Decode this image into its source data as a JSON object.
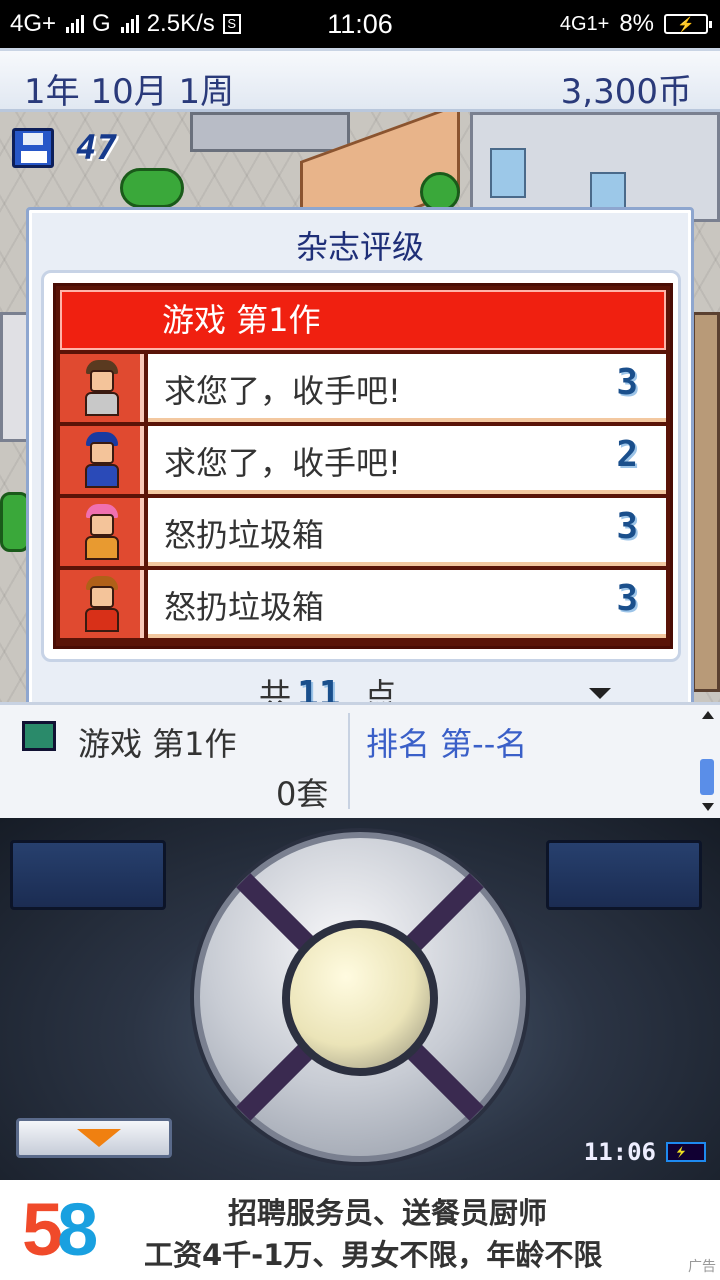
{
  "status_bar": {
    "network_left": "4G+",
    "network_mid": "G",
    "speed": "2.5K/s",
    "app_icon": "S",
    "time": "11:06",
    "network_right": "4G1+",
    "battery_pct": "8%"
  },
  "header": {
    "date": "1年 10月 1周",
    "money": "3,300币"
  },
  "hud": {
    "save_count": "47"
  },
  "dialog": {
    "title": "杂志评级",
    "game_title": "游戏 第1作",
    "reviews": [
      {
        "comment": "求您了，收手吧!",
        "score": "3",
        "hair": "#5a3a20",
        "shirt": "#c8c8c8"
      },
      {
        "comment": "求您了，收手吧!",
        "score": "2",
        "hair": "#1a3aa0",
        "shirt": "#2a4ab8"
      },
      {
        "comment": "怒扔垃圾箱",
        "score": "3",
        "hair": "#f070b0",
        "shirt": "#e89a30"
      },
      {
        "comment": "怒扔垃圾箱",
        "score": "3",
        "hair": "#b06018",
        "shirt": "#d83018"
      }
    ],
    "total_prefix": "共",
    "total_points": "11",
    "total_suffix": "点"
  },
  "info_panel": {
    "game_name": "游戏 第1作",
    "sets_sold": "0套",
    "rank": "排名 第--名"
  },
  "controller": {
    "clock": "11:06"
  },
  "ad": {
    "logo_5": "5",
    "logo_8": "8",
    "line1": "招聘服务员、送餐员厨师",
    "line2": "工资4千-1万、男女不限，年龄不限",
    "tag": "广告"
  }
}
